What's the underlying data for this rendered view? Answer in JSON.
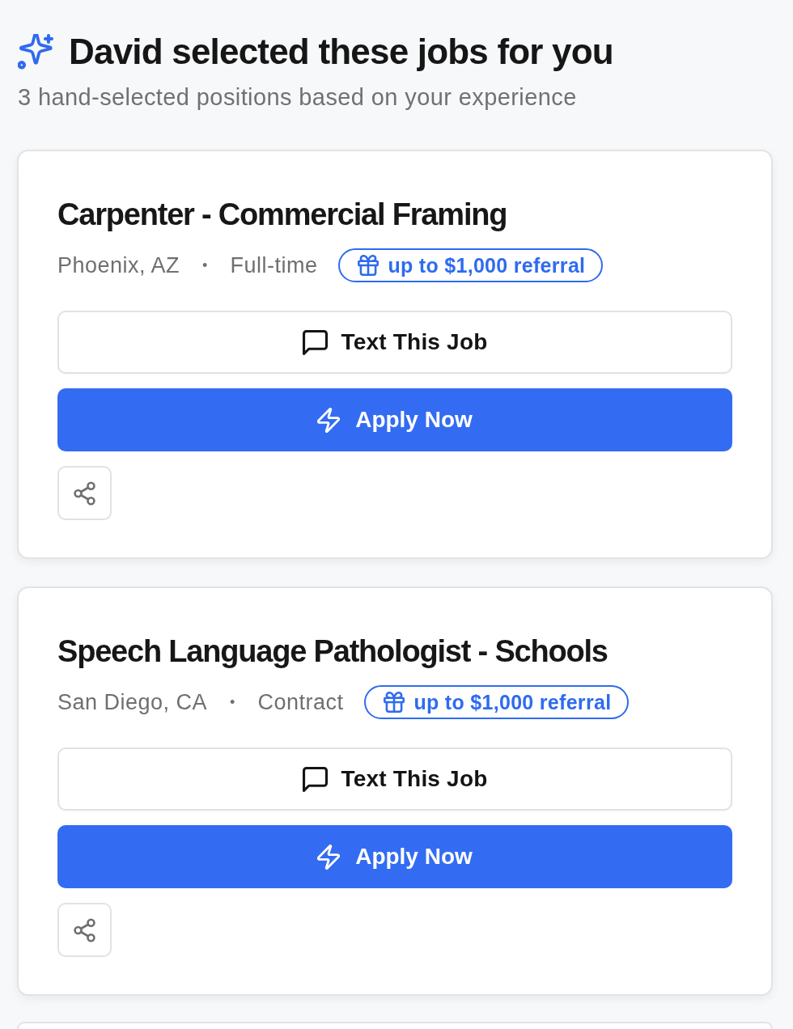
{
  "header": {
    "title": "David selected these jobs for you",
    "subtitle": "3 hand-selected positions based on your experience"
  },
  "jobs": [
    {
      "title": "Carpenter - Commercial Framing",
      "location": "Phoenix, AZ",
      "separator": "•",
      "employment_type": "Full-time",
      "referral": "up to $1,000 referral",
      "text_button": "Text This Job",
      "apply_button": "Apply Now"
    },
    {
      "title": "Speech Language Pathologist - Schools",
      "location": "San Diego, CA",
      "separator": "•",
      "employment_type": "Contract",
      "referral": "up to $1,000 referral",
      "text_button": "Text This Job",
      "apply_button": "Apply Now"
    }
  ]
}
